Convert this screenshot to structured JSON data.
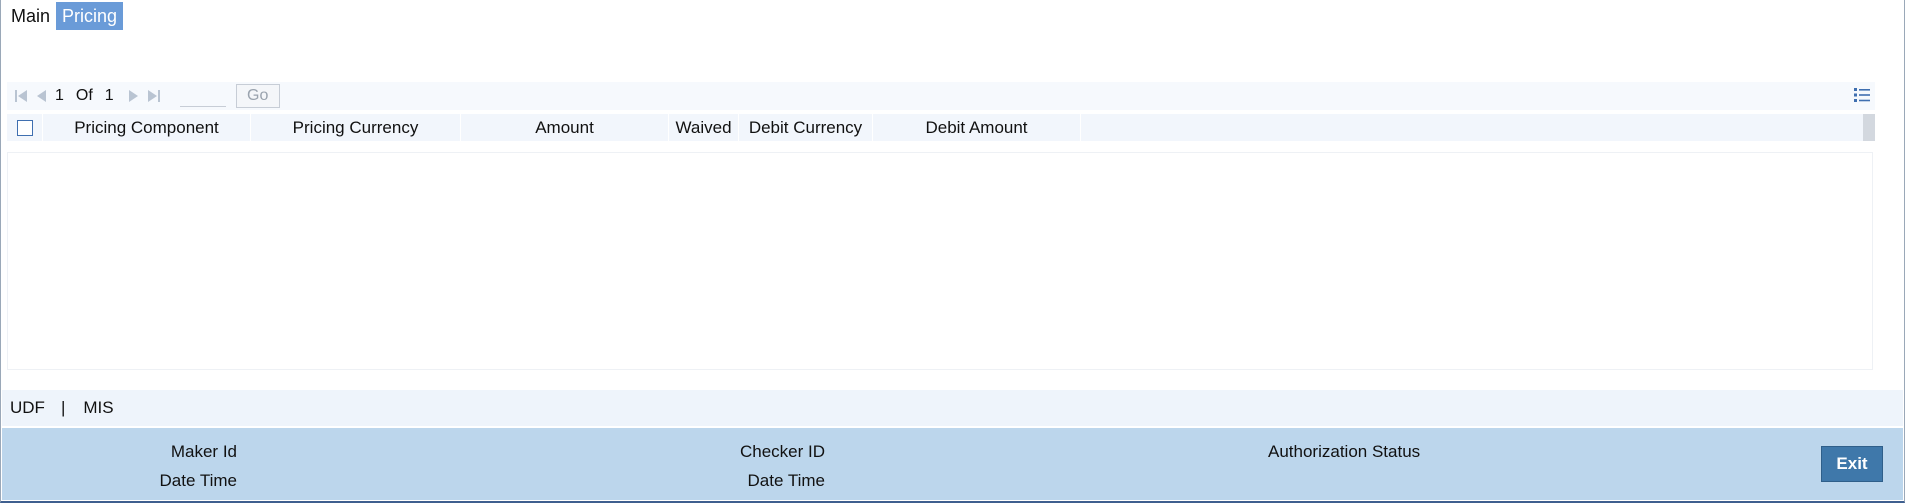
{
  "tabs": [
    {
      "label": "Main",
      "active": false
    },
    {
      "label": "Pricing",
      "active": true
    }
  ],
  "pager": {
    "current_page": "1",
    "of_label": "Of",
    "total_pages": "1",
    "page_input_value": "",
    "go_label": "Go"
  },
  "grid": {
    "columns": [
      "Pricing Component",
      "Pricing Currency",
      "Amount",
      "Waived",
      "Debit Currency",
      "Debit Amount"
    ],
    "rows": []
  },
  "links": {
    "udf": "UDF",
    "separator": "|",
    "mis": "MIS"
  },
  "footer": {
    "maker_id_label": "Maker Id",
    "maker_datetime_label": "Date Time",
    "checker_id_label": "Checker ID",
    "checker_datetime_label": "Date Time",
    "authorization_status_label": "Authorization Status",
    "exit_label": "Exit"
  },
  "colors": {
    "active_tab": "#6a9bd8",
    "footer_bg": "#bcd6ec",
    "exit_button": "#3f78aa"
  },
  "icons": {
    "first_page": "first-page-icon",
    "previous_page": "previous-page-icon",
    "next_page": "next-page-icon",
    "last_page": "last-page-icon",
    "list_view": "list-view-icon"
  }
}
